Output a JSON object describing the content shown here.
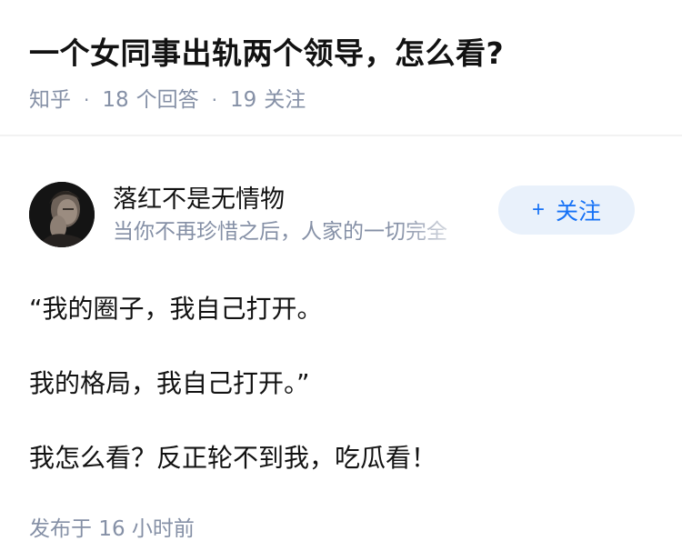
{
  "question": {
    "title": "一个女同事出轨两个领导，怎么看?",
    "source": "知乎",
    "answers_count": "18",
    "answers_label": "个回答",
    "followers_count": "19",
    "followers_label": "关注",
    "separator": "·"
  },
  "answer": {
    "author": {
      "name": "落红不是无情物",
      "bio": "当你不再珍惜之后，人家的一切完全"
    },
    "follow_button": {
      "plus": "+",
      "label": "关注"
    },
    "paragraphs": [
      "“我的圈子，我自己打开。",
      "我的格局，我自己打开。”",
      "我怎么看？反正轮不到我，吃瓜看！"
    ],
    "published_label": "发布于",
    "published_time": "16 小时前"
  },
  "colors": {
    "text": "#121212",
    "meta": "#8590a6",
    "accent": "#1772f6",
    "follow_bg": "#e9f1fb"
  }
}
